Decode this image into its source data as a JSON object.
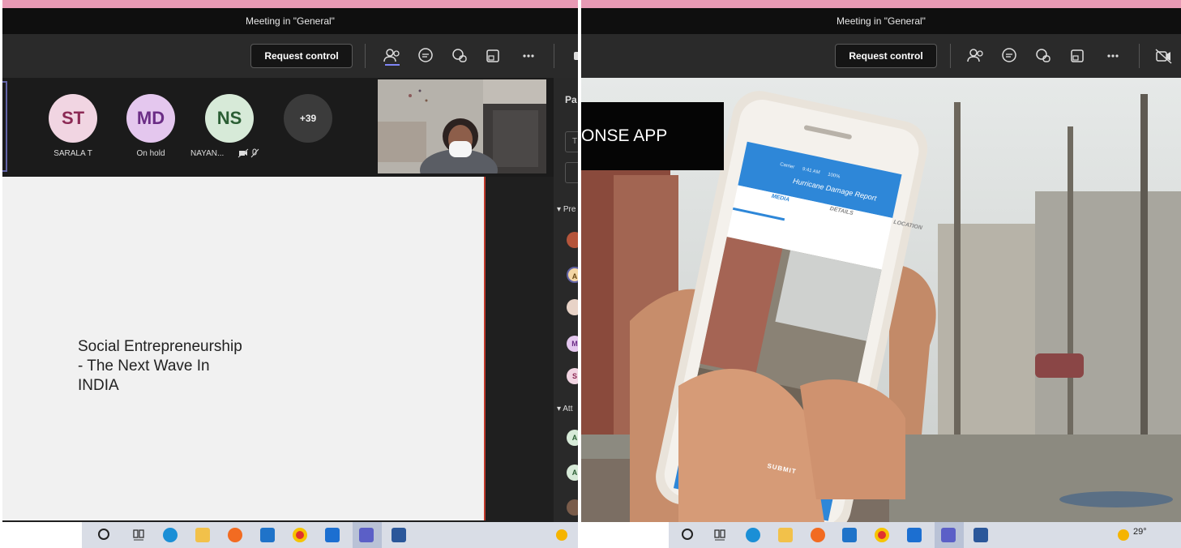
{
  "left_window": {
    "title": "Meeting in \"General\"",
    "toolbar": {
      "request_control": "Request control"
    },
    "participants": [
      {
        "initials": "ST",
        "name": "SARALA T",
        "bg": "#f1d5e2",
        "fg": "#8c2a55"
      },
      {
        "initials": "MD",
        "name": "On hold",
        "bg": "#e4c7ee",
        "fg": "#6b2d86"
      },
      {
        "initials": "NS",
        "name": "NAYAN...",
        "bg": "#d7ead8",
        "fg": "#2b5e34"
      }
    ],
    "overflow_count": "+39",
    "slide_text": "Social Entrepreneurship\n- The Next Wave In\nINDIA",
    "sidebar": {
      "header": "Pa",
      "search_fragment": "T",
      "section_presenters": "Pre",
      "section_attendees": "Att",
      "avatar_letters": [
        "A",
        "M",
        "S",
        "A",
        "A"
      ]
    }
  },
  "right_window": {
    "title": "Meeting in \"General\"",
    "toolbar": {
      "request_control": "Request control"
    },
    "video_caption": "ONSE APP",
    "phone_app": {
      "status_carrier": "Carrier",
      "status_time": "9:41 AM",
      "status_battery": "100%",
      "header_title": "Hurricane Damage Report",
      "tabs": [
        "MEDIA",
        "DETAILS",
        "LOCATION"
      ],
      "submit": "SUBMIT"
    },
    "weather": "29°"
  },
  "colors": {
    "pink_strip": "#e89ab5",
    "teams_accent": "#7f85f5",
    "recording_red": "#c0392b"
  },
  "icons": [
    "participants-icon",
    "chat-icon",
    "reactions-icon",
    "rooms-icon",
    "more-icon",
    "camera-off-icon"
  ]
}
